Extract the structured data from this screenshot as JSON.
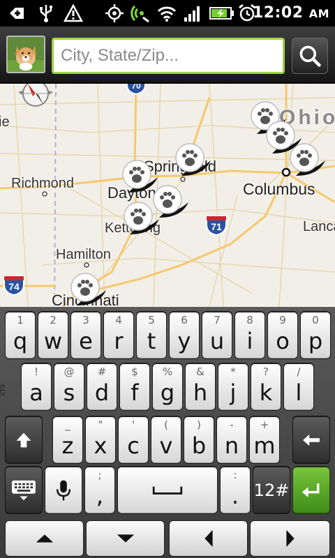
{
  "status_bar": {
    "time": "12:02",
    "ampm": "AM",
    "icons": [
      "add-notification-icon",
      "usb-icon",
      "warning-icon",
      "gps-icon",
      "sync-icon",
      "wifi-icon",
      "signal-icon",
      "battery-charging-icon",
      "alarm-icon"
    ]
  },
  "header": {
    "search_placeholder": "City, State/Zip...",
    "search_value": "",
    "avatar": "puppy-photo",
    "search_button_icon": "search-icon"
  },
  "map": {
    "cities": [
      {
        "name": "Richmond"
      },
      {
        "name": "Dayton"
      },
      {
        "name": "Springfield"
      },
      {
        "name": "Columbus"
      },
      {
        "name": "Kettering"
      },
      {
        "name": "Hamilton"
      },
      {
        "name": "Cincinnati"
      },
      {
        "name": "Lancaster"
      },
      {
        "name": "ie"
      }
    ],
    "region_label": "Ohio",
    "highway_shields": [
      "70",
      "71",
      "74"
    ],
    "pin_icon": "paw-print-pin-icon"
  },
  "keyboard": {
    "side_label": "XT9",
    "row1": [
      {
        "sec": "1",
        "pri": "q"
      },
      {
        "sec": "2",
        "pri": "w"
      },
      {
        "sec": "3",
        "pri": "e"
      },
      {
        "sec": "4",
        "pri": "r"
      },
      {
        "sec": "5",
        "pri": "t"
      },
      {
        "sec": "6",
        "pri": "y"
      },
      {
        "sec": "7",
        "pri": "u"
      },
      {
        "sec": "8",
        "pri": "i"
      },
      {
        "sec": "9",
        "pri": "o"
      },
      {
        "sec": "0",
        "pri": "p"
      }
    ],
    "row2": [
      {
        "sec": "!",
        "pri": "a"
      },
      {
        "sec": "@",
        "pri": "s"
      },
      {
        "sec": "#",
        "pri": "d"
      },
      {
        "sec": "$",
        "pri": "f"
      },
      {
        "sec": "%",
        "pri": "g"
      },
      {
        "sec": "&",
        "pri": "h"
      },
      {
        "sec": "*",
        "pri": "j"
      },
      {
        "sec": "?",
        "pri": "k"
      },
      {
        "sec": "/",
        "pri": "l"
      }
    ],
    "row3": [
      {
        "sec": "_",
        "pri": "z"
      },
      {
        "sec": "\"",
        "pri": "x"
      },
      {
        "sec": "'",
        "pri": "c"
      },
      {
        "sec": "(",
        "pri": "v"
      },
      {
        "sec": ")",
        "pri": "b"
      },
      {
        "sec": "-",
        "pri": "n"
      },
      {
        "sec": "+",
        "pri": "m"
      }
    ],
    "row4": {
      "comma_sec": ";",
      "comma_pri": ",",
      "period_sec": ":",
      "period_pri": ".",
      "num_label": "12#"
    }
  }
}
